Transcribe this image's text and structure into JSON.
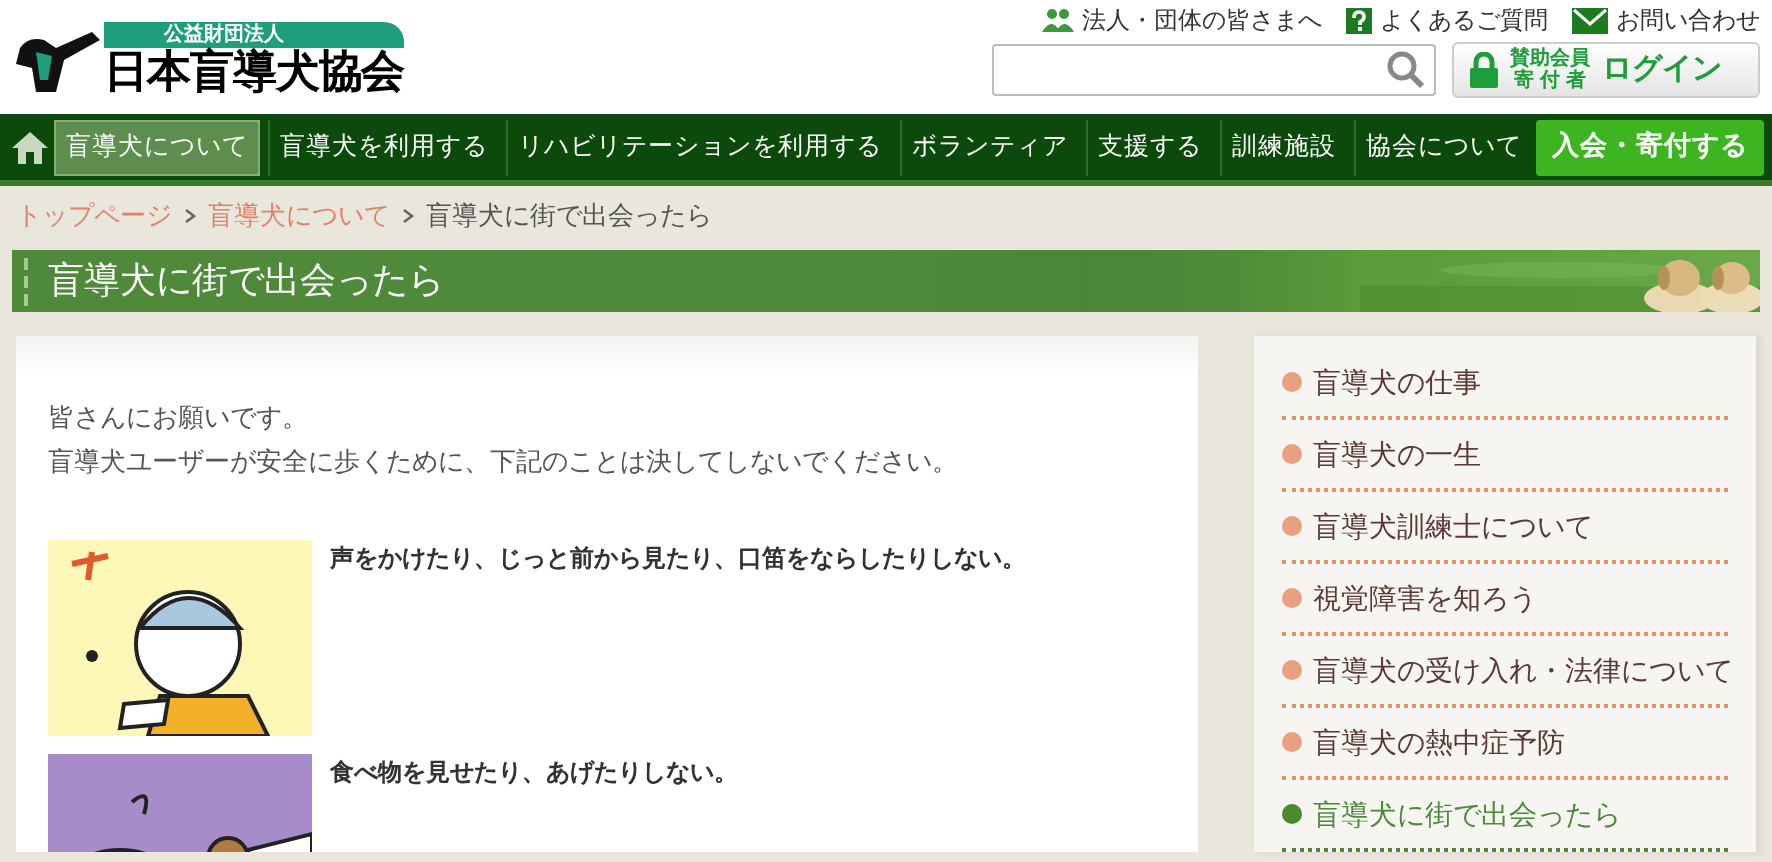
{
  "logo": {
    "subtitle": "公益財団法人",
    "name": "日本盲導犬協会"
  },
  "top_links": [
    {
      "kind": "people",
      "label": "法人・団体の皆さまへ"
    },
    {
      "kind": "help",
      "label": "よくあるご質問"
    },
    {
      "kind": "mail",
      "label": "お問い合わせ"
    }
  ],
  "login_button": {
    "line_1": "賛助会員",
    "line_2": "寄 付 者",
    "label": "ログイン"
  },
  "nav": [
    {
      "kind": "home",
      "selected": false
    },
    {
      "kind": "link",
      "label": "盲導犬について",
      "selected": true
    },
    {
      "kind": "link",
      "label": "盲導犬を利用する",
      "selected": false
    },
    {
      "kind": "link",
      "label": "リハビリテーションを利用する",
      "selected": false
    },
    {
      "kind": "link",
      "label": "ボランティア",
      "selected": false
    },
    {
      "kind": "link",
      "label": "支援する",
      "selected": false
    },
    {
      "kind": "link",
      "label": "訓練施設",
      "selected": false
    },
    {
      "kind": "link",
      "label": "協会について",
      "selected": false
    },
    {
      "kind": "cta",
      "label": "入会・寄付する",
      "selected": false
    }
  ],
  "breadcrumbs": [
    {
      "label": "トップページ",
      "link": true
    },
    {
      "label": "盲導犬について",
      "link": true
    },
    {
      "label": "盲導犬に街で出会ったら",
      "link": false
    }
  ],
  "page_title": "盲導犬に街で出会ったら",
  "intro": [
    "皆さんにお願いです。",
    "盲導犬ユーザーが安全に歩くために、下記のことは決してしないでください。"
  ],
  "rules": [
    {
      "kind": "picture",
      "text": "声をかけたり、じっと前から見たり、口笛をならしたりしない。"
    },
    {
      "kind": "picture",
      "text": "食べ物を見せたり、あげたりしない。"
    }
  ],
  "sidebar": [
    {
      "label": "盲導犬の仕事",
      "selected": false
    },
    {
      "label": "盲導犬の一生",
      "selected": false
    },
    {
      "label": "盲導犬訓練士について",
      "selected": false
    },
    {
      "label": "視覚障害を知ろう",
      "selected": false
    },
    {
      "label": "盲導犬の受け入れ・法律について",
      "selected": false
    },
    {
      "label": "盲導犬の熱中症予防",
      "selected": false
    },
    {
      "label": "盲導犬に街で出会ったら",
      "selected": true
    }
  ]
}
